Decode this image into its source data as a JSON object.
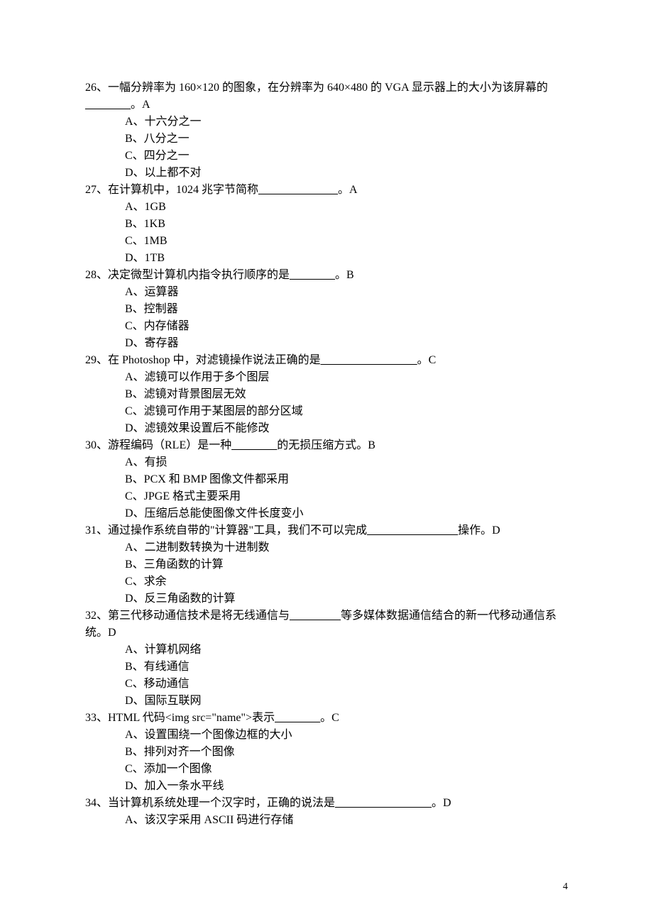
{
  "page_number": "4",
  "questions": [
    {
      "num": "26",
      "stem_pre": "、一幅分辨率为 160×120 的图象，在分辨率为 640×480 的 VGA 显示器上的大小为该屏幕的",
      "blank": "________",
      "stem_post": "。",
      "answer": "A",
      "options": [
        "A、十六分之一",
        "B、八分之一",
        "C、四分之一",
        "D、以上都不对"
      ]
    },
    {
      "num": "27",
      "stem_pre": "、在计算机中，1024 兆字节简称",
      "blank": "______________",
      "stem_post": "。",
      "answer": "A",
      "options": [
        "A、1GB",
        "B、1KB",
        "C、1MB",
        "D、1TB"
      ]
    },
    {
      "num": "28",
      "stem_pre": "、决定微型计算机内指令执行顺序的是",
      "blank": "________",
      "stem_post": "。",
      "answer": "B",
      "options": [
        "A、运算器",
        "B、控制器",
        "C、内存储器",
        "D、寄存器"
      ]
    },
    {
      "num": "29",
      "stem_pre": "、在 Photoshop 中，对滤镜操作说法正确的是",
      "blank": "_________________",
      "stem_post": "。",
      "answer": "C",
      "options": [
        "A、滤镜可以作用于多个图层",
        "B、滤镜对背景图层无效",
        "C、滤镜可作用于某图层的部分区域",
        "D、滤镜效果设置后不能修改"
      ]
    },
    {
      "num": "30",
      "stem_pre": "、游程编码（RLE）是一种",
      "blank": "________",
      "stem_post": "的无损压缩方式。",
      "answer": "B",
      "options": [
        "A、有损",
        "B、PCX 和 BMP 图像文件都采用",
        "C、JPGE 格式主要采用",
        "D、压缩后总能使图像文件长度变小"
      ]
    },
    {
      "num": "31",
      "stem_pre": "、通过操作系统自带的\"计算器\"工具，我们不可以完成",
      "blank": "________________",
      "stem_post": "操作。",
      "answer": "D",
      "options": [
        "A、二进制数转换为十进制数",
        "B、三角函数的计算",
        "C、求余",
        "D、反三角函数的计算"
      ]
    },
    {
      "num": "32",
      "stem_pre": "、第三代移动通信技术是将无线通信与",
      "blank": "_________",
      "stem_post": "等多媒体数据通信结合的新一代移动通信系统。",
      "answer": "D",
      "options": [
        "A、计算机网络",
        "B、有线通信",
        "C、移动通信",
        "D、国际互联网"
      ]
    },
    {
      "num": "33",
      "stem_pre": "、HTML 代码<img src=\"name\">表示",
      "blank": "________",
      "stem_post": "。",
      "answer": "C",
      "options": [
        "A、设置围绕一个图像边框的大小",
        "B、排列对齐一个图像",
        "C、添加一个图像",
        "D、加入一条水平线"
      ]
    },
    {
      "num": "34",
      "stem_pre": "、当计算机系统处理一个汉字时，正确的说法是",
      "blank": "_________________",
      "stem_post": "。",
      "answer": "D",
      "options": [
        "A、该汉字采用 ASCII 码进行存储"
      ]
    }
  ]
}
